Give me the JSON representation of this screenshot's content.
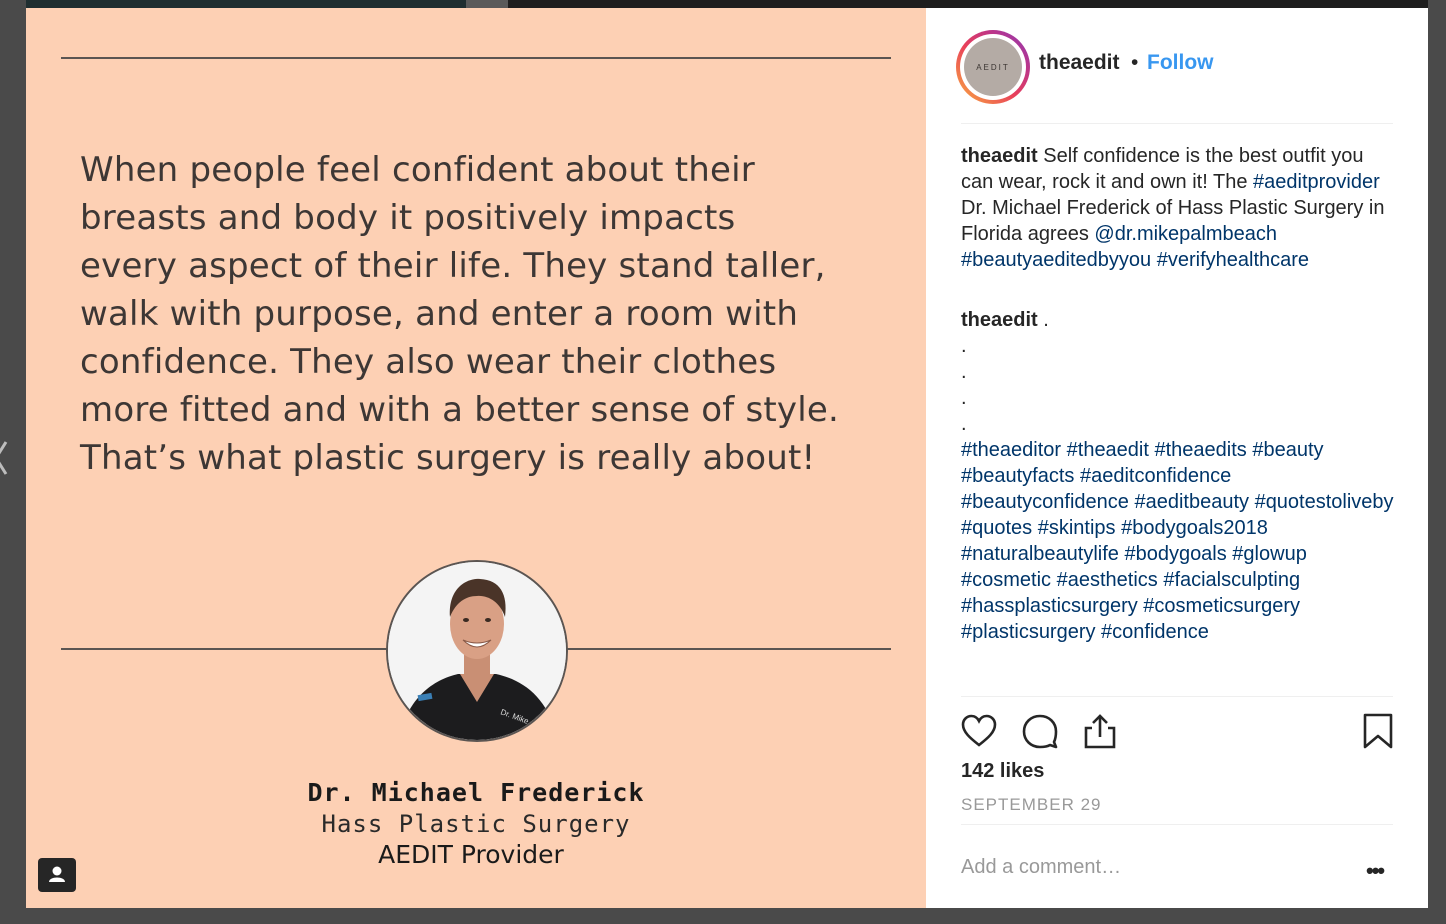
{
  "post_image": {
    "quote_lines": [
      "When people feel confident about their",
      "breasts and body it positively impacts",
      "every aspect of their life. They stand taller,",
      "walk with purpose, and enter a room with",
      "confidence. They also wear their clothes",
      "more fitted and with a better sense of style.",
      "That’s what plastic surgery is really about!"
    ],
    "signature_name": "Dr. Michael Frederick",
    "signature_org": "Hass Plastic Surgery",
    "signature_role": "AEDIT Provider",
    "portrait_badge": "Dr. Mike",
    "background_color": "#fdd0b4"
  },
  "header": {
    "avatar_text": "AEDIT",
    "username": "theaedit",
    "separator": "•",
    "follow_label": "Follow"
  },
  "caption": {
    "author": "theaedit",
    "text_1": " Self confidence is the best outfit you can wear, rock it and own it! The ",
    "tag_provider": "#aeditprovider",
    "text_2": " Dr. Michael Frederick of Hass Plastic Surgery in Florida agrees ",
    "mention": "@dr.mikepalmbeach",
    "tag_2": "#beautyaeditedbyyou",
    "tag_3": "#verifyhealthcare"
  },
  "comment_1": {
    "author": "theaedit",
    "text": " .",
    "dots": [
      ".",
      ".",
      ".",
      "."
    ],
    "hashtags": "#theaeditor #theaedit #theaedits #beauty #beautyfacts #aeditconfidence #beautyconfidence #aeditbeauty #quotestoliveby #quotes #skintips #bodygoals2018 #naturalbeautylife #bodygoals #glowup #cosmetic #aesthetics #facialsculpting #hassplasticsurgery #cosmeticsurgery #plasticsurgery #confidence"
  },
  "actions": {
    "like_icon": "heart-icon",
    "comment_icon": "speech-bubble-icon",
    "share_icon": "share-icon",
    "save_icon": "bookmark-icon"
  },
  "likes_text": "142 likes",
  "date_text": "SEPTEMBER 29",
  "comment_box": {
    "placeholder": "Add a comment…",
    "more_label": "•••"
  },
  "colors": {
    "link": "#003569",
    "follow": "#3897f0",
    "text": "#262626",
    "muted": "#999999"
  }
}
